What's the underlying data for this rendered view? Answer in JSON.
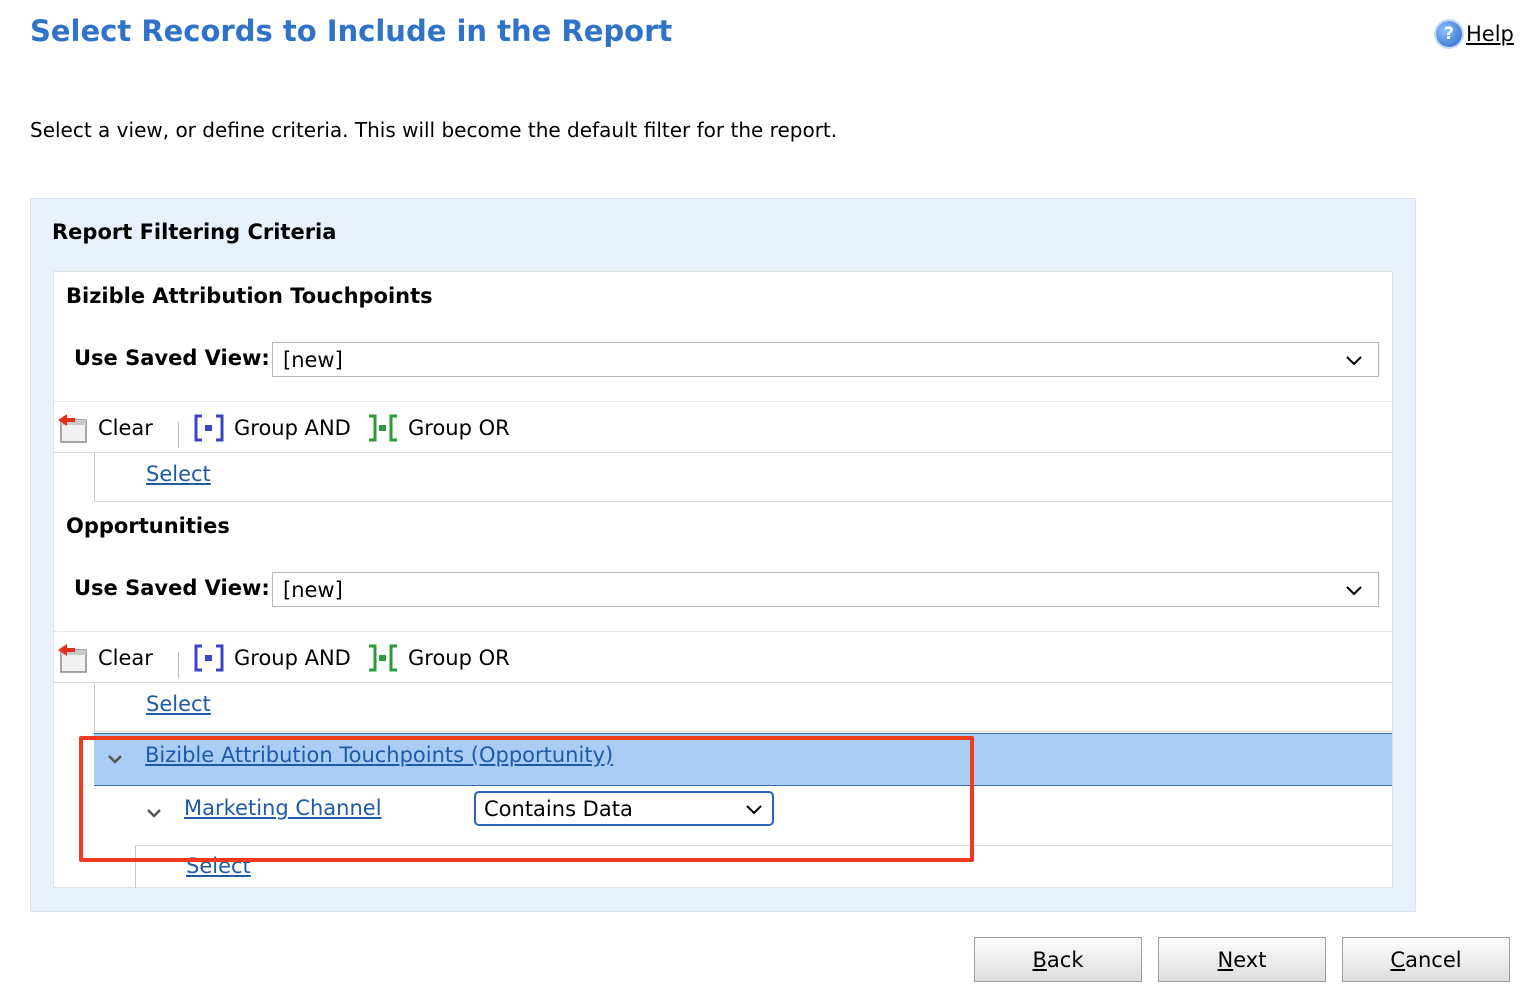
{
  "header": {
    "title": "Select Records to Include in the Report",
    "help_label": "Help"
  },
  "instructions": "Select a view, or define criteria. This will become the default filter for the report.",
  "panel": {
    "heading": "Report Filtering Criteria"
  },
  "sections": [
    {
      "title": "Bizible Attribution Touchpoints",
      "saved_view_label": "Use Saved View:",
      "saved_view_value": "[new]",
      "toolbar": {
        "clear": "Clear",
        "group_and": "Group AND",
        "group_or": "Group OR"
      },
      "select_link": "Select"
    },
    {
      "title": "Opportunities",
      "saved_view_label": "Use Saved View:",
      "saved_view_value": "[new]",
      "toolbar": {
        "clear": "Clear",
        "group_and": "Group AND",
        "group_or": "Group OR"
      },
      "select_link": "Select",
      "related_entity": {
        "label": "Bizible Attribution Touchpoints (Opportunity)",
        "condition": {
          "field": "Marketing Channel",
          "operator": "Contains Data"
        },
        "select_link": "Select"
      }
    }
  ],
  "buttons": {
    "back": {
      "accel": "B",
      "rest": "ack"
    },
    "next": {
      "accel": "N",
      "rest": "ext"
    },
    "cancel": {
      "accel": "C",
      "rest": "ancel"
    }
  },
  "colors": {
    "title": "#2f73c8",
    "link": "#1f5aa8",
    "highlight_border": "#f03a20",
    "group_row_bg": "#a9cdf4",
    "panel_bg": "#e9f1fc"
  },
  "icons": [
    "help-icon",
    "clear-icon",
    "group-and-icon",
    "group-or-icon",
    "chevron-down-icon",
    "collapse-icon"
  ]
}
